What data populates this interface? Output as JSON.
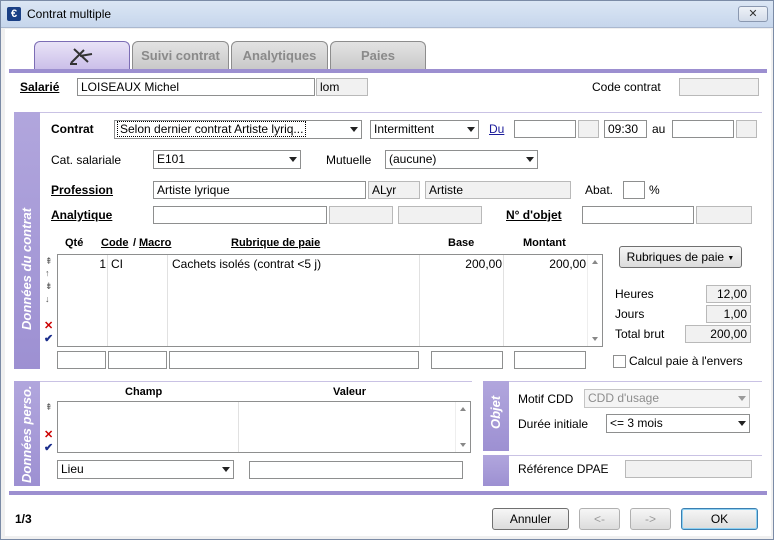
{
  "window": {
    "title": "Contrat multiple",
    "close": "✕"
  },
  "tabs": [
    {
      "label": ""
    },
    {
      "label": "Suivi contrat"
    },
    {
      "label": "Analytiques"
    },
    {
      "label": "Paies"
    }
  ],
  "header": {
    "salarie_label": "Salarié",
    "salarie_value": "LOISEAUX Michel",
    "salarie_code": "lom",
    "code_contrat_label": "Code contrat",
    "code_contrat_value": ""
  },
  "contract": {
    "section_title": "Données du contrat",
    "contrat_label": "Contrat",
    "contrat_value": "Selon dernier contrat Artiste lyriq...",
    "type_value": "Intermittent",
    "du_label": "Du",
    "du_time": "09:30",
    "au_label": "au",
    "cat_label": "Cat. salariale",
    "cat_value": "E101",
    "mutuelle_label": "Mutuelle",
    "mutuelle_value": "(aucune)",
    "profession_label": "Profession",
    "profession_value": "Artiste lyrique",
    "profession_code": "ALyr",
    "profession_type": "Artiste",
    "abat_label": "Abat.",
    "abat_unit": "%",
    "analytique_label": "Analytique",
    "objet_label": "N° d'objet"
  },
  "pay_table": {
    "headers": {
      "qte": "Qté",
      "code": "Code",
      "slash": "/",
      "macro": "Macro",
      "rubrique": "Rubrique de paie",
      "base": "Base",
      "montant": "Montant"
    },
    "rows": [
      {
        "qte": "1",
        "code": "CI",
        "rubrique": "Cachets isolés (contrat <5 j)",
        "base": "200,00",
        "montant": "200,00"
      }
    ],
    "rubriques_button": "Rubriques de paie",
    "heures_label": "Heures",
    "heures_value": "12,00",
    "jours_label": "Jours",
    "jours_value": "1,00",
    "total_label": "Total brut",
    "total_value": "200,00",
    "calcul_label": "Calcul paie à l'envers"
  },
  "perso": {
    "section_title": "Données perso.",
    "champ_header": "Champ",
    "valeur_header": "Valeur",
    "lieu_value": "Lieu"
  },
  "objet": {
    "section_title": "Objet",
    "motif_label": "Motif CDD",
    "motif_value": "CDD d'usage",
    "duree_label": "Durée initiale",
    "duree_value": "<= 3 mois",
    "dpae_label": "Référence DPAE"
  },
  "footer": {
    "page": "1/3",
    "annuler": "Annuler",
    "prev": "<-",
    "next": "->",
    "ok": "OK"
  },
  "colors": {
    "accent": "#9c8fd0",
    "panel": "#e4def5"
  }
}
